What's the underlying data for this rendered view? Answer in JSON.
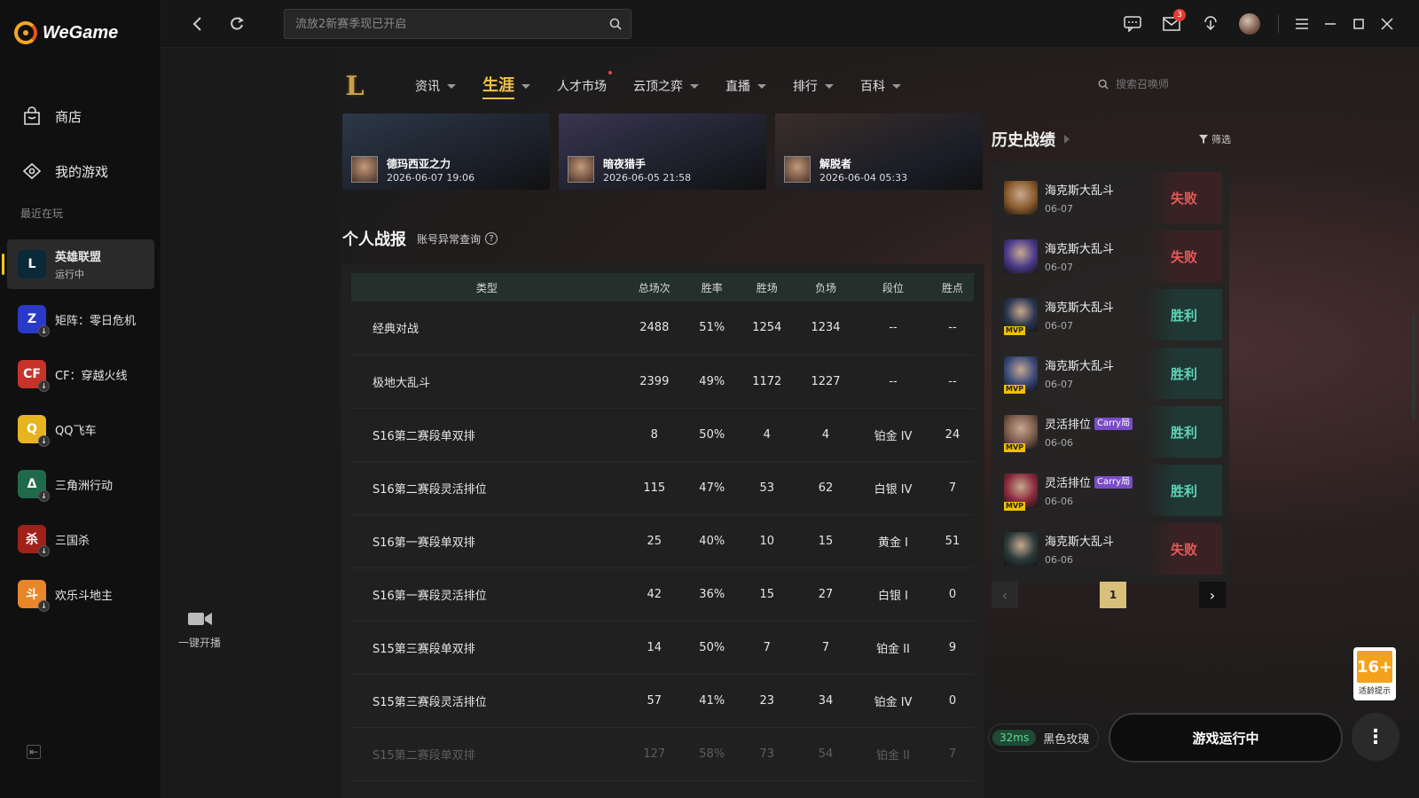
{
  "app": {
    "name": "WeGame",
    "colors": {
      "accent": "#f0c14b",
      "win": "#5fd4b8",
      "lose": "#e55a5a",
      "brand": "#f5a623"
    }
  },
  "sidebar": {
    "nav": [
      {
        "label": "商店",
        "icon": "bag-icon"
      },
      {
        "label": "我的游戏",
        "icon": "gamepad-icon"
      }
    ],
    "recent_label": "最近在玩",
    "games": [
      {
        "name": "英雄联盟",
        "sub": "运行中",
        "icon": "lol-icon",
        "color": "#0a2a3a",
        "glyph": "L",
        "active": true,
        "download": false
      },
      {
        "name": "矩阵：零日危机",
        "sub": "",
        "icon": "matrix-icon",
        "color": "#2a3ac8",
        "glyph": "Z",
        "download": true
      },
      {
        "name": "CF：穿越火线",
        "sub": "",
        "icon": "cf-icon",
        "color": "#c8322a",
        "glyph": "CF",
        "download": true
      },
      {
        "name": "QQ飞车",
        "sub": "",
        "icon": "qq-speed-icon",
        "color": "#e6b420",
        "glyph": "Q",
        "download": true
      },
      {
        "name": "三角洲行动",
        "sub": "",
        "icon": "delta-icon",
        "color": "#1f6a4a",
        "glyph": "Δ",
        "download": true
      },
      {
        "name": "三国杀",
        "sub": "",
        "icon": "sanguosha-icon",
        "color": "#a0201a",
        "glyph": "杀",
        "download": true
      },
      {
        "name": "欢乐斗地主",
        "sub": "",
        "icon": "doudizhu-icon",
        "color": "#e8862a",
        "glyph": "斗",
        "download": true
      }
    ]
  },
  "topbar": {
    "search_placeholder": "流放2新赛季现已开启",
    "mail_badge": "3"
  },
  "game_nav": {
    "logo": "L",
    "tabs": [
      {
        "label": "资讯",
        "caret": true,
        "dot": false,
        "active": false
      },
      {
        "label": "生涯",
        "caret": true,
        "dot": false,
        "active": true
      },
      {
        "label": "人才市场",
        "caret": false,
        "dot": true,
        "active": false
      },
      {
        "label": "云顶之弈",
        "caret": true,
        "dot": false,
        "active": false
      },
      {
        "label": "直播",
        "caret": true,
        "dot": false,
        "active": false
      },
      {
        "label": "排行",
        "caret": true,
        "dot": false,
        "active": false
      },
      {
        "label": "百科",
        "caret": true,
        "dot": false,
        "active": false
      }
    ],
    "search_placeholder": "搜索召唤师"
  },
  "highlights": [
    {
      "champion": "德玛西亚之力",
      "time": "2026-06-07 19:06",
      "bg": "#2c3848"
    },
    {
      "champion": "暗夜猎手",
      "time": "2026-06-05 21:58",
      "bg": "#3a3550"
    },
    {
      "champion": "解脱者",
      "time": "2026-06-04 05:33",
      "bg": "#3a2e2a"
    }
  ],
  "stats": {
    "title": "个人战报",
    "account_check": "账号异常查询",
    "columns": [
      "类型",
      "总场次",
      "胜率",
      "胜场",
      "负场",
      "段位",
      "胜点"
    ],
    "rows": [
      [
        "经典对战",
        "2488",
        "51%",
        "1254",
        "1234",
        "--",
        "--"
      ],
      [
        "极地大乱斗",
        "2399",
        "49%",
        "1172",
        "1227",
        "--",
        "--"
      ],
      [
        "S16第二赛段单双排",
        "8",
        "50%",
        "4",
        "4",
        "铂金 IV",
        "24"
      ],
      [
        "S16第二赛段灵活排位",
        "115",
        "47%",
        "53",
        "62",
        "白银 IV",
        "7"
      ],
      [
        "S16第一赛段单双排",
        "25",
        "40%",
        "10",
        "15",
        "黄金 I",
        "51"
      ],
      [
        "S16第一赛段灵活排位",
        "42",
        "36%",
        "15",
        "27",
        "白银 I",
        "0"
      ],
      [
        "S15第三赛段单双排",
        "14",
        "50%",
        "7",
        "7",
        "铂金 II",
        "9"
      ],
      [
        "S15第三赛段灵活排位",
        "57",
        "41%",
        "23",
        "34",
        "铂金 IV",
        "0"
      ],
      [
        "S15第二赛段单双排",
        "127",
        "58%",
        "73",
        "54",
        "铂金 II",
        "7"
      ]
    ]
  },
  "live": {
    "label": "一键开播"
  },
  "history": {
    "title": "历史战绩",
    "filter": "筛选",
    "matches": [
      {
        "mode": "海克斯大乱斗",
        "date": "06-07",
        "result": "失败",
        "win": false,
        "mvp": false,
        "carry": false,
        "champ_color": "#8a5a2a"
      },
      {
        "mode": "海克斯大乱斗",
        "date": "06-07",
        "result": "失败",
        "win": false,
        "mvp": false,
        "carry": false,
        "champ_color": "#4a3a8a"
      },
      {
        "mode": "海克斯大乱斗",
        "date": "06-07",
        "result": "胜利",
        "win": true,
        "mvp": true,
        "carry": false,
        "champ_color": "#2a3550"
      },
      {
        "mode": "海克斯大乱斗",
        "date": "06-07",
        "result": "胜利",
        "win": true,
        "mvp": true,
        "carry": false,
        "champ_color": "#3a4a7a"
      },
      {
        "mode": "灵活排位",
        "date": "06-06",
        "result": "胜利",
        "win": true,
        "mvp": true,
        "carry": true,
        "carry_label": "Carry局",
        "champ_color": "#7a5a4a"
      },
      {
        "mode": "灵活排位",
        "date": "06-06",
        "result": "胜利",
        "win": true,
        "mvp": true,
        "carry": true,
        "carry_label": "Carry局",
        "champ_color": "#8a2a3a"
      },
      {
        "mode": "海克斯大乱斗",
        "date": "06-06",
        "result": "失败",
        "win": false,
        "mvp": false,
        "carry": false,
        "champ_color": "#2a3a3a"
      }
    ],
    "page": "1",
    "mvp_label": "MVP"
  },
  "bottom": {
    "ping": "32ms",
    "server": "黑色玫瑰",
    "run_label": "游戏运行中",
    "age": "16+",
    "age_sub": "适龄提示"
  }
}
